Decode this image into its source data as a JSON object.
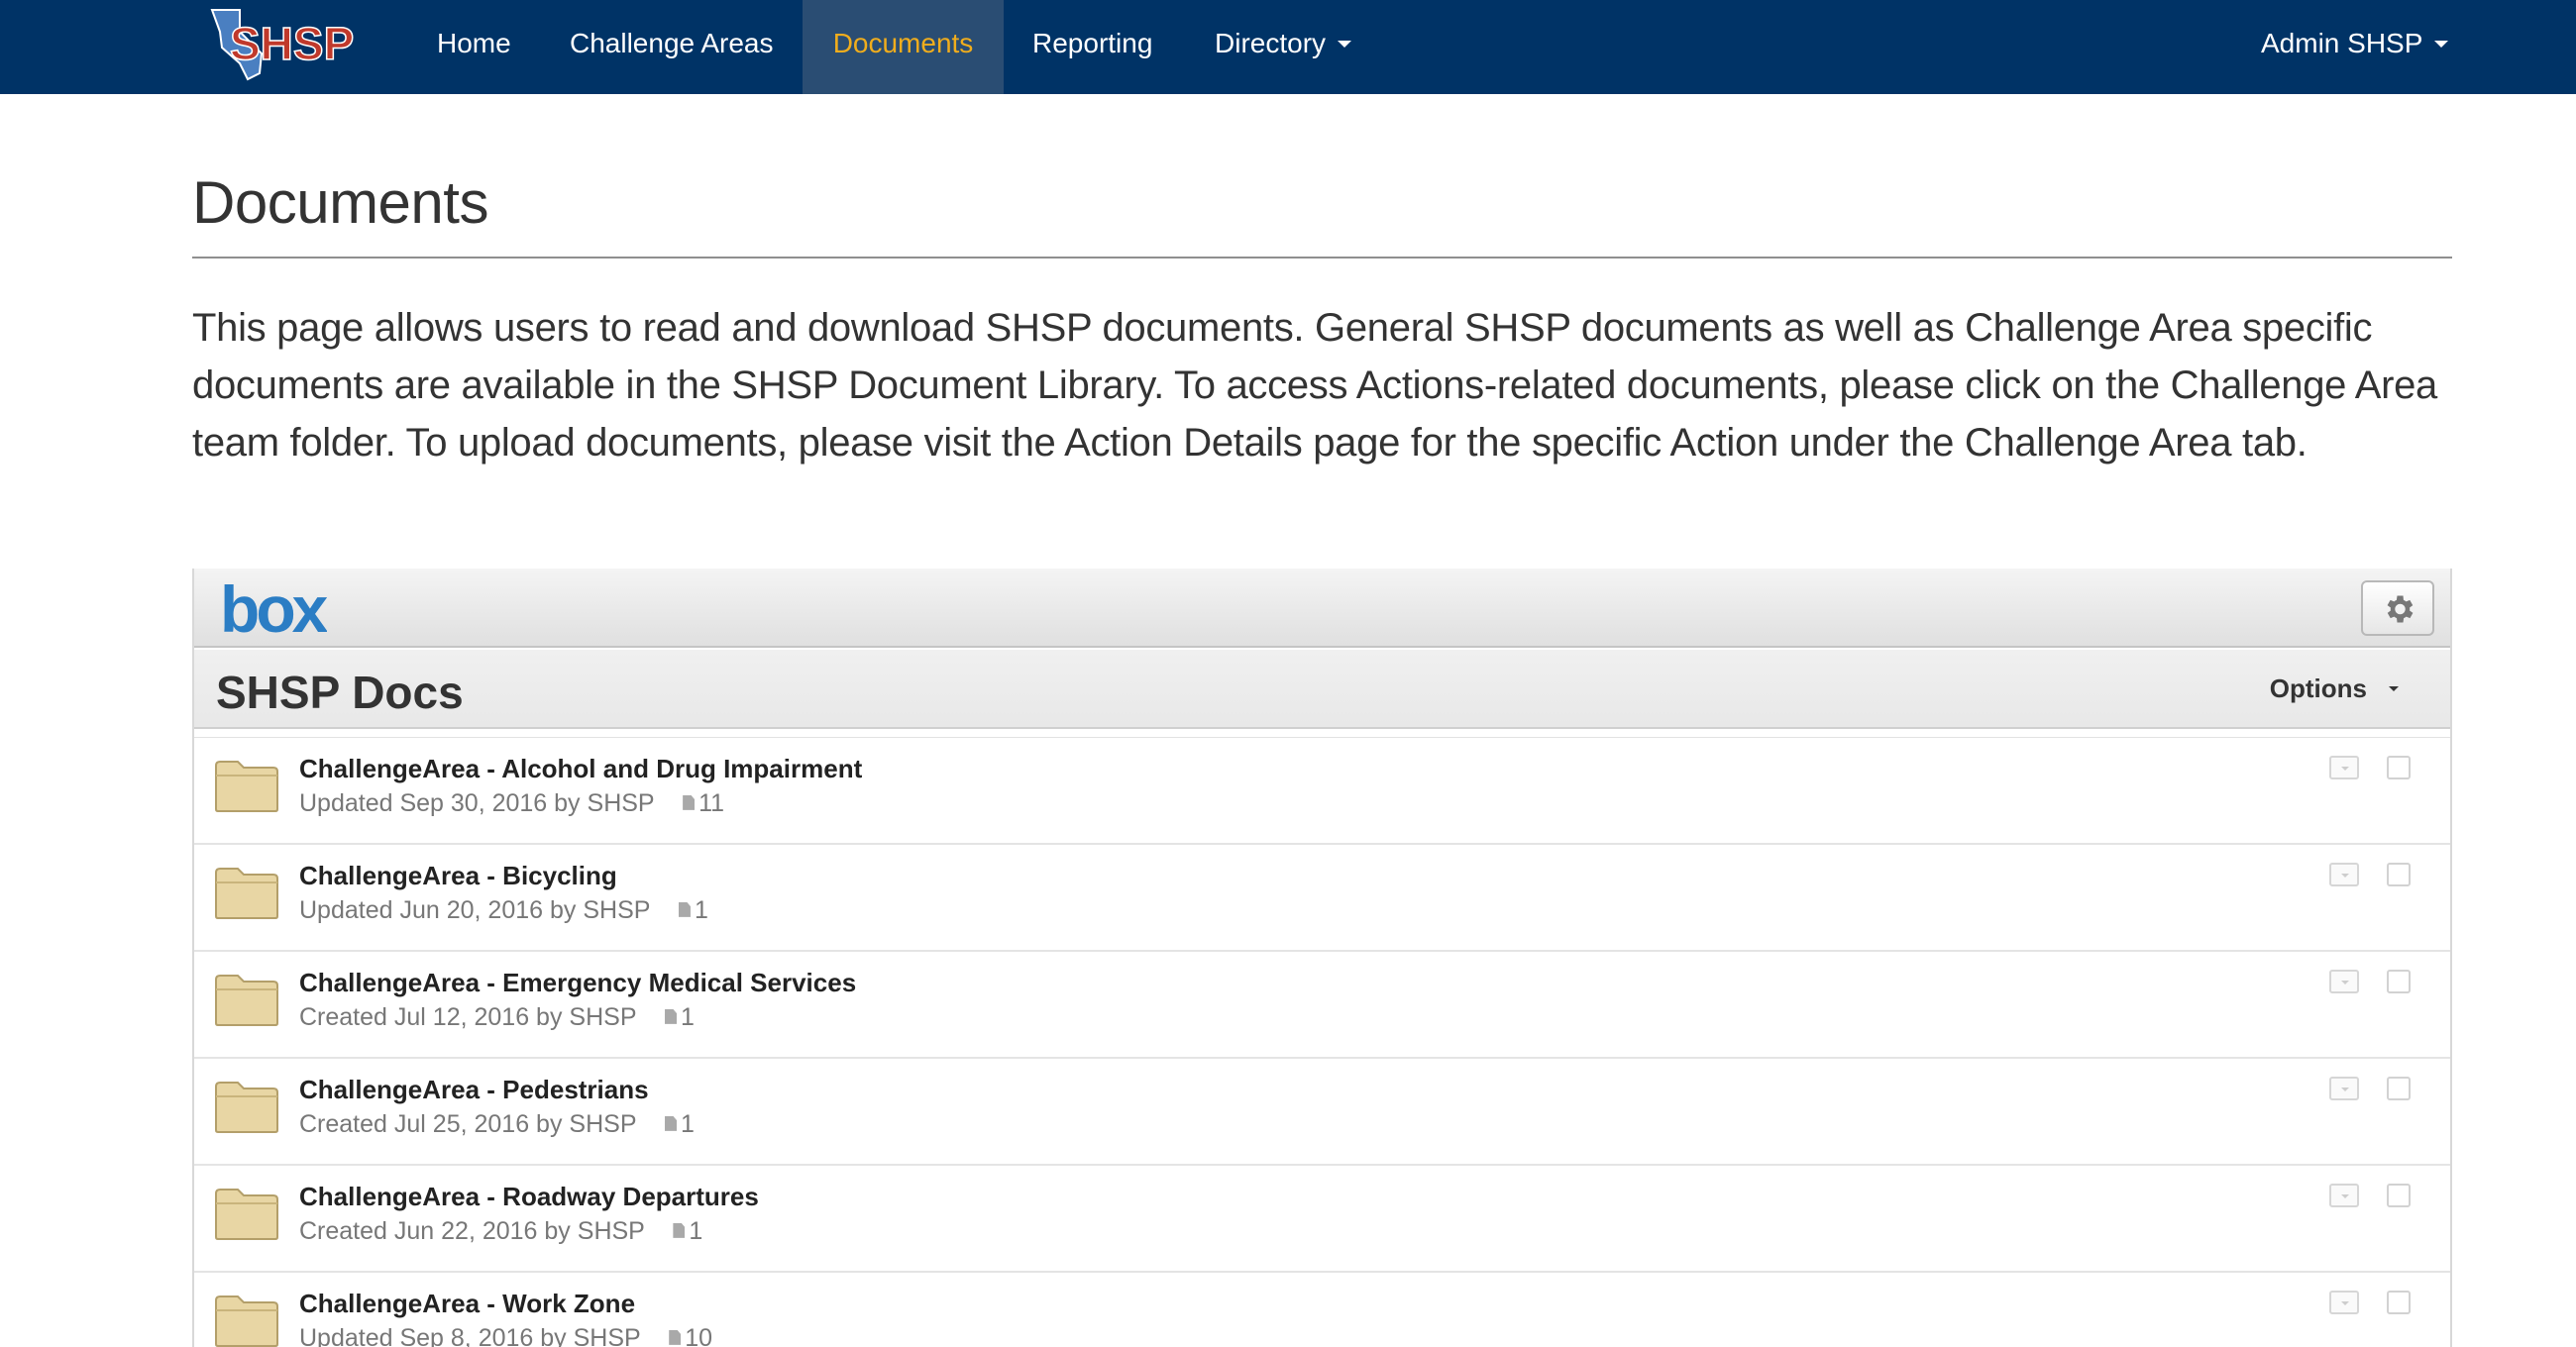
{
  "app": {
    "logo_text": "SHSP"
  },
  "nav": {
    "items": [
      {
        "label": "Home"
      },
      {
        "label": "Challenge Areas"
      },
      {
        "label": "Documents",
        "active": true
      },
      {
        "label": "Reporting"
      },
      {
        "label": "Directory"
      }
    ],
    "user_menu_label": "Admin SHSP",
    "active_color": "#f0ad1d",
    "bar_color": "#003366"
  },
  "page": {
    "title": "Documents",
    "intro": "This page allows users to read and download SHSP documents. General SHSP documents as well as Challenge Area specific documents are available in the SHSP Document Library. To access Actions-related documents, please click on the Challenge Area team folder. To upload documents, please visit the Action Details page for the specific Action under the Challenge Area tab."
  },
  "box": {
    "brand": "box",
    "settings_icon": "gear-icon",
    "folder_title": "SHSP Docs",
    "options_label": "Options",
    "items": [
      {
        "name": "ChallengeArea - Alcohol and Drug Impairment",
        "status": "Updated Sep 30, 2016 by",
        "user": "SHSP",
        "count": "11"
      },
      {
        "name": "ChallengeArea - Bicycling",
        "status": "Updated Jun 20, 2016 by",
        "user": "SHSP",
        "count": "1"
      },
      {
        "name": "ChallengeArea - Emergency Medical Services",
        "status": "Created Jul 12, 2016 by",
        "user": "SHSP",
        "count": "1"
      },
      {
        "name": "ChallengeArea - Pedestrians",
        "status": "Created Jul 25, 2016 by",
        "user": "SHSP",
        "count": "1"
      },
      {
        "name": "ChallengeArea - Roadway Departures",
        "status": "Created Jun 22, 2016 by",
        "user": "SHSP",
        "count": "1"
      },
      {
        "name": "ChallengeArea - Work Zone",
        "status": "Updated Sep 8, 2016 by",
        "user": "SHSP",
        "count": "10"
      }
    ]
  }
}
